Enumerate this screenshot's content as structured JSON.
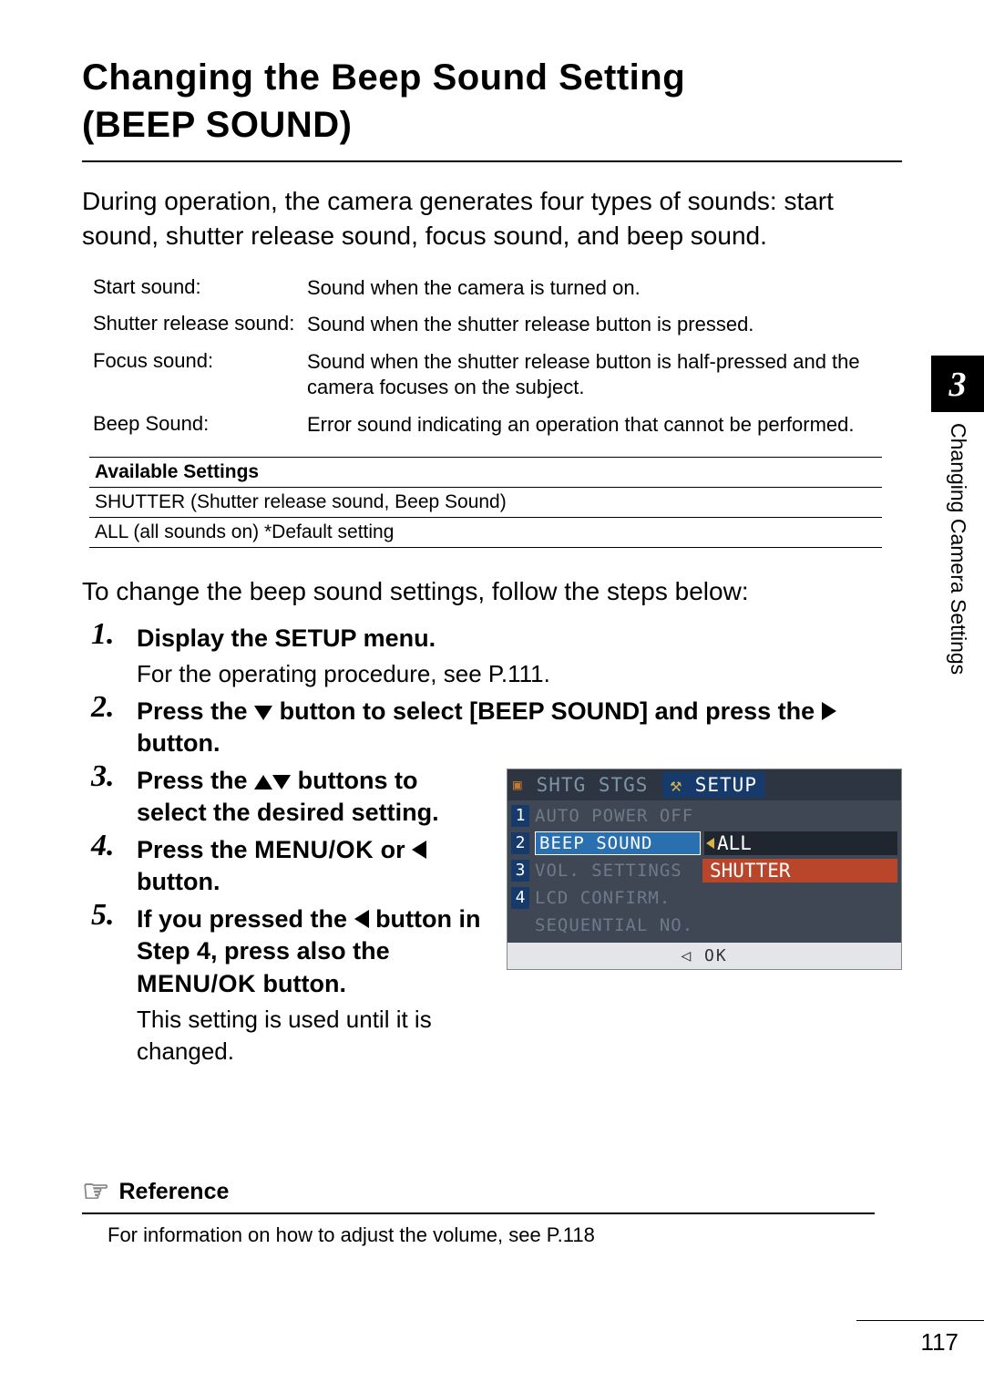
{
  "title_line1": "Changing the Beep Sound Setting",
  "title_line2": "(BEEP SOUND)",
  "intro": "During operation, the camera generates four types of sounds: start sound, shutter release sound, focus sound, and beep sound.",
  "defs": [
    {
      "label": "Start sound:",
      "desc": "Sound when the camera is turned on."
    },
    {
      "label": "Shutter release sound:",
      "desc": "Sound when the shutter release button is pressed."
    },
    {
      "label": "Focus sound:",
      "desc": "Sound when the shutter release button is half-pressed and the camera focuses on the subject."
    },
    {
      "label": "Beep Sound:",
      "desc": "Error sound indicating an operation that cannot be performed."
    }
  ],
  "settings_header": "Available Settings",
  "settings_rows": [
    "SHUTTER (Shutter release sound, Beep Sound)",
    "ALL (all sounds on) *Default setting"
  ],
  "follow": "To change the beep sound settings, follow the steps below:",
  "steps": {
    "s1_title": "Display the SETUP menu.",
    "s1_body": "For the operating procedure, see P.111.",
    "s2_a": "Press the ",
    "s2_b": " button to select [BEEP SOUND] and press the ",
    "s2_c": " button.",
    "s3_a": "Press the ",
    "s3_b": " buttons to select the desired setting.",
    "s4_a": "Press the ",
    "s4_menuok": "MENU/OK",
    "s4_b": " or ",
    "s4_c": " button.",
    "s5_a": "If you pressed the ",
    "s5_b": " button in Step 4, press also the ",
    "s5_menuok": "MENU/OK",
    "s5_c": " button.",
    "s5_body": "This setting is used until it is changed."
  },
  "lcd": {
    "tab1": "SHTG STGS",
    "tab2_icon": "⚒",
    "tab2": "SETUP",
    "rows": {
      "r1": "AUTO POWER OFF",
      "r2": "BEEP SOUND",
      "r3": "VOL. SETTINGS",
      "r4": "LCD CONFIRM.",
      "r5": "SEQUENTIAL NO."
    },
    "opt_all": "ALL",
    "opt_shutter": "SHUTTER",
    "ok": "OK"
  },
  "reference": {
    "heading": "Reference",
    "body": "For information on how to adjust the volume, see P.118"
  },
  "chapter_num": "3",
  "chapter_title": "Changing Camera Settings",
  "page_number": "117"
}
